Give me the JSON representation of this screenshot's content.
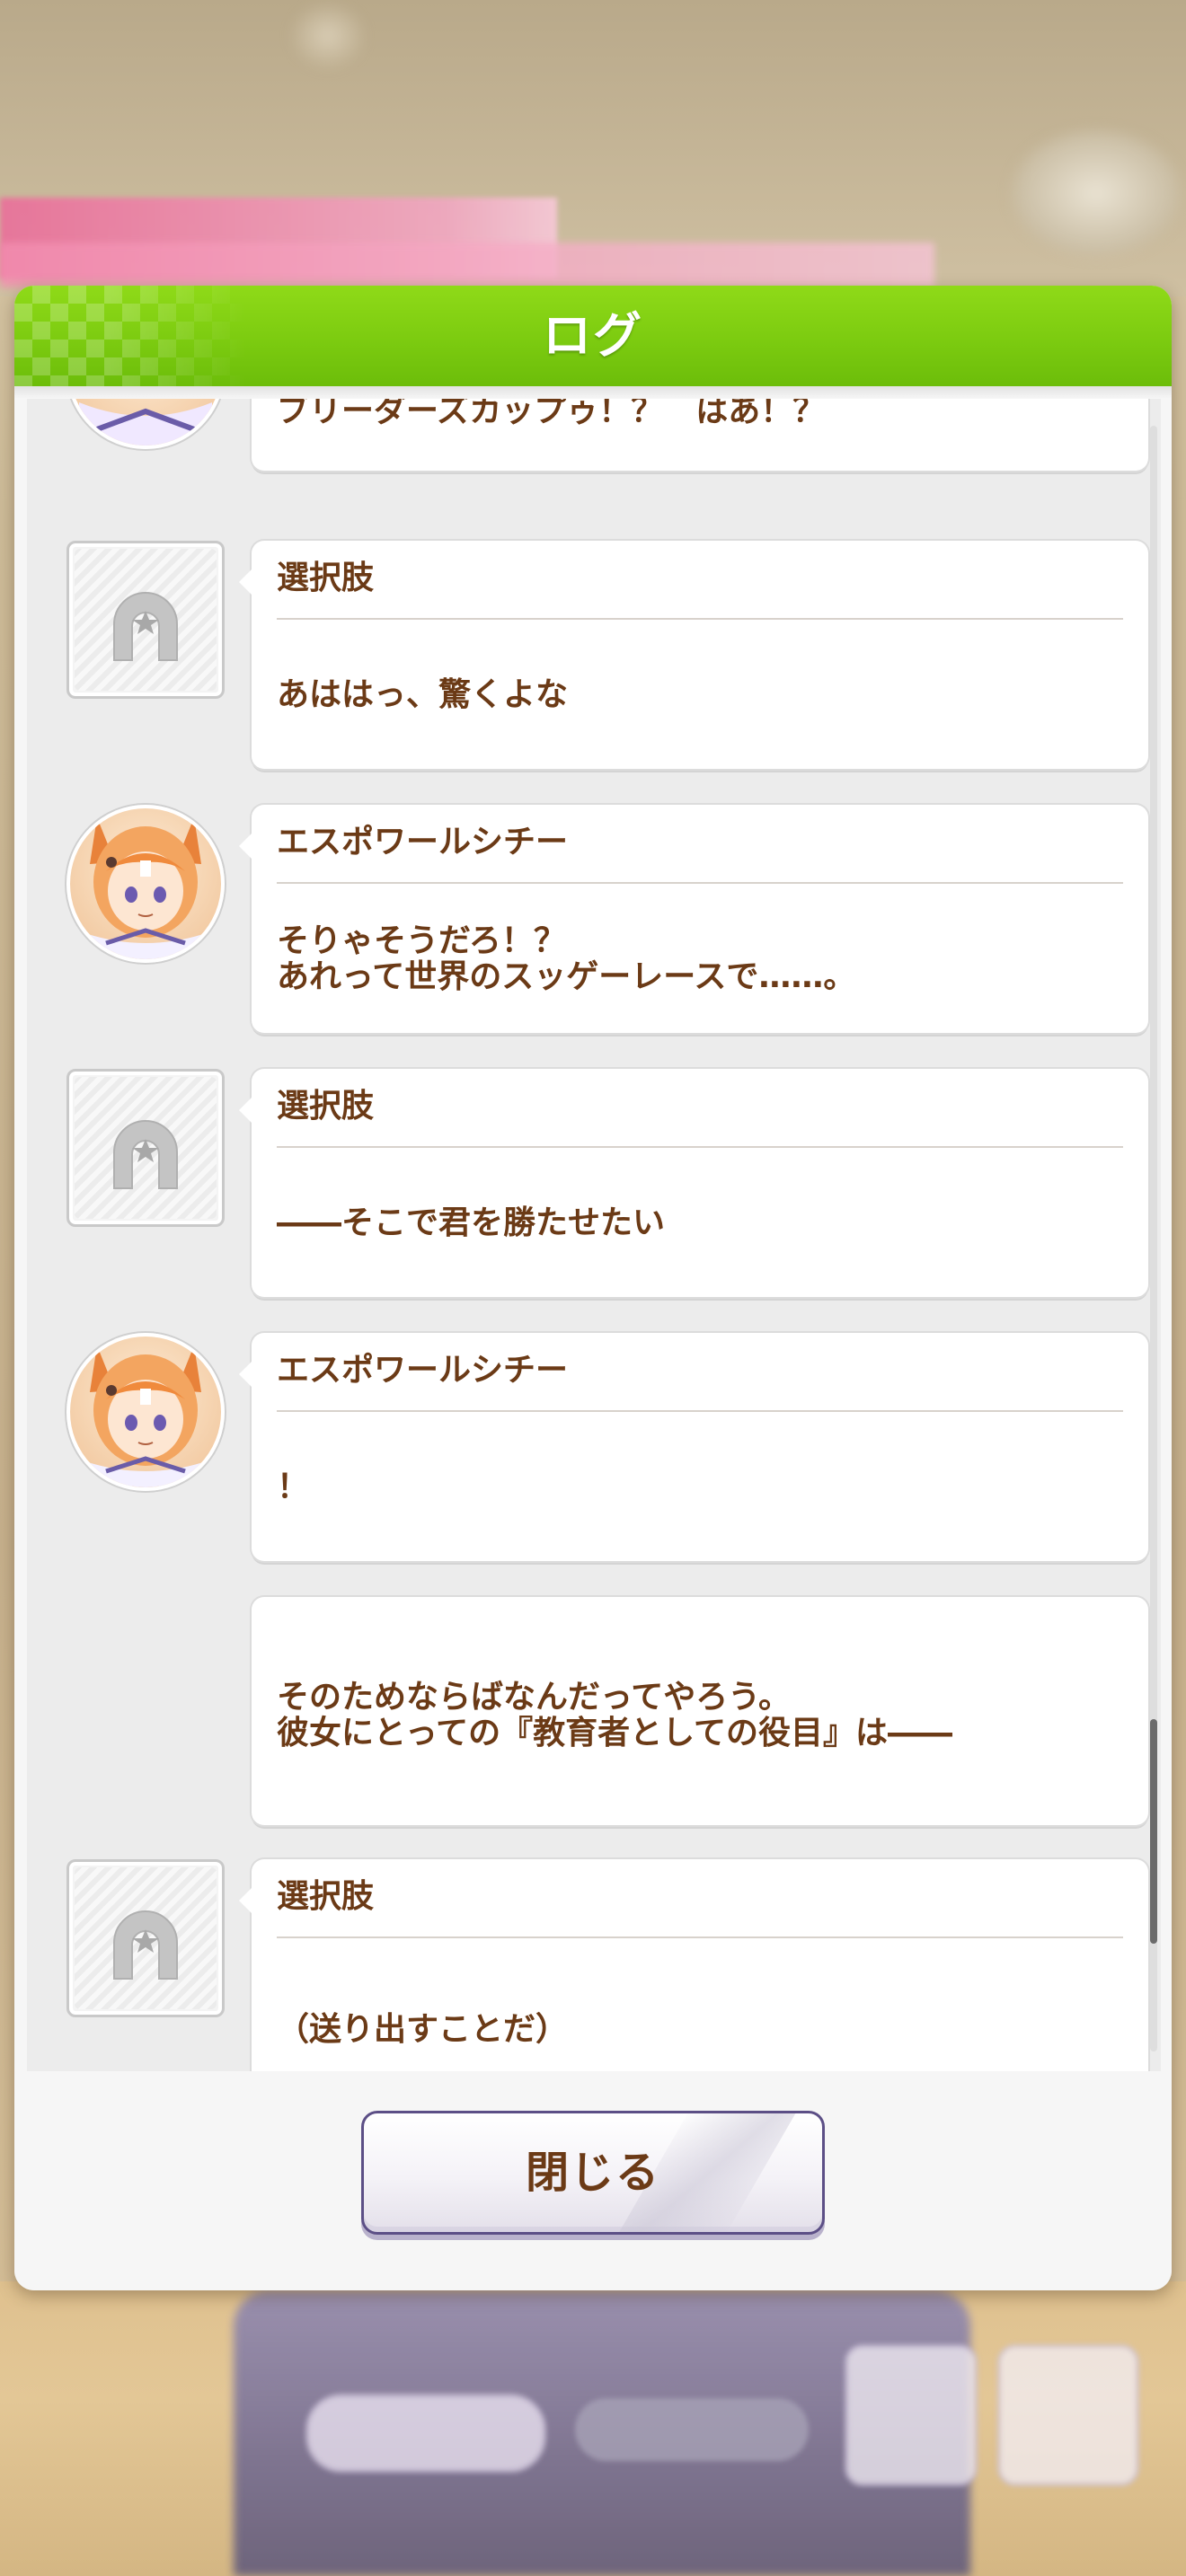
{
  "dialog": {
    "title": "ログ",
    "close_label": "閉じる",
    "header_color": "#7ccb10",
    "text_color": "#6b3a16"
  },
  "log": {
    "entries": [
      {
        "avatar": "character-avatar",
        "speaker": "",
        "message": "ブリーダーズカップゥ！？　はあ！？"
      },
      {
        "avatar": "choice-horseshoe-icon",
        "speaker": "選択肢",
        "message": "あははっ、驚くよな"
      },
      {
        "avatar": "character-avatar",
        "speaker": "エスポワールシチー",
        "message": "そりゃそうだろ！？\nあれって世界のスッゲーレースで……。"
      },
      {
        "avatar": "choice-horseshoe-icon",
        "speaker": "選択肢",
        "message": "――そこで君を勝たせたい"
      },
      {
        "avatar": "character-avatar",
        "speaker": "エスポワールシチー",
        "message": "！"
      },
      {
        "avatar": "",
        "speaker": "",
        "message": "そのためならばなんだってやろう。\n彼女にとっての『教育者としての役目』は――"
      },
      {
        "avatar": "choice-horseshoe-icon",
        "speaker": "選択肢",
        "message": "（送り出すことだ）"
      }
    ]
  }
}
